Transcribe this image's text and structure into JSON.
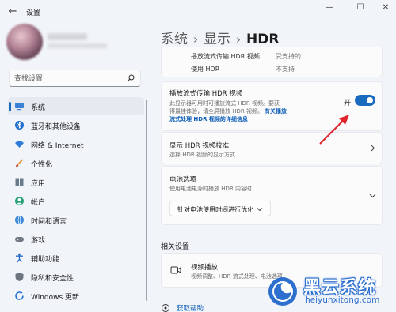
{
  "window": {
    "app_title": "设置",
    "controls": {
      "minimize": "—",
      "maximize": "☐",
      "close": "✕"
    }
  },
  "search": {
    "placeholder": "查找设置"
  },
  "nav": {
    "items": [
      {
        "label": "系统",
        "icon": "monitor-icon",
        "active": true
      },
      {
        "label": "蓝牙和其他设备",
        "icon": "bluetooth-icon"
      },
      {
        "label": "网络 & Internet",
        "icon": "wifi-icon"
      },
      {
        "label": "个性化",
        "icon": "brush-icon"
      },
      {
        "label": "应用",
        "icon": "apps-icon"
      },
      {
        "label": "帐户",
        "icon": "account-icon"
      },
      {
        "label": "时间和语言",
        "icon": "globe-clock-icon"
      },
      {
        "label": "游戏",
        "icon": "gamepad-icon"
      },
      {
        "label": "辅助功能",
        "icon": "accessibility-icon"
      },
      {
        "label": "隐私和安全性",
        "icon": "shield-icon"
      },
      {
        "label": "Windows 更新",
        "icon": "windows-update-icon"
      }
    ]
  },
  "header": {
    "crumbs": [
      "系统",
      "显示",
      "HDR"
    ],
    "separator": "›"
  },
  "status_card": {
    "rows": [
      {
        "key": "播放流式传输 HDR 视频",
        "value": "受支持的"
      },
      {
        "key": "使用 HDR",
        "value": "不支持"
      }
    ]
  },
  "stream_card": {
    "title": "播放流式传输 HDR 视频",
    "desc_line1": "此显示器可用时可播放流式 HDR 视频。要获",
    "desc_line2": "得最佳体验，请全屏播放 HDR 视频。",
    "link_part1": "有关播放",
    "link_part2": "流式处理 HDR 视频的详细信息",
    "toggle_label": "开",
    "toggle_on": true
  },
  "calib_card": {
    "title": "显示 HDR 视频校准",
    "subtitle": "选择 HDR 视频的显示方式"
  },
  "battery_card": {
    "title": "电池选项",
    "subtitle": "使用电池电源时播放 HDR 内容时",
    "dropdown_value": "针对电池使用时间进行优化"
  },
  "related": {
    "title": "相关设置",
    "video_playback": {
      "title": "视频播放",
      "subtitle": "视频调整、HDR 流式处理、电池选项"
    }
  },
  "help": {
    "label": "获取帮助"
  },
  "watermark": {
    "text": "黑云系统",
    "url": "heiyunxitong.com"
  },
  "colors": {
    "accent": "#1a6bc0",
    "link": "#0f5fb8",
    "annotation_arrow": "#e0262b"
  }
}
